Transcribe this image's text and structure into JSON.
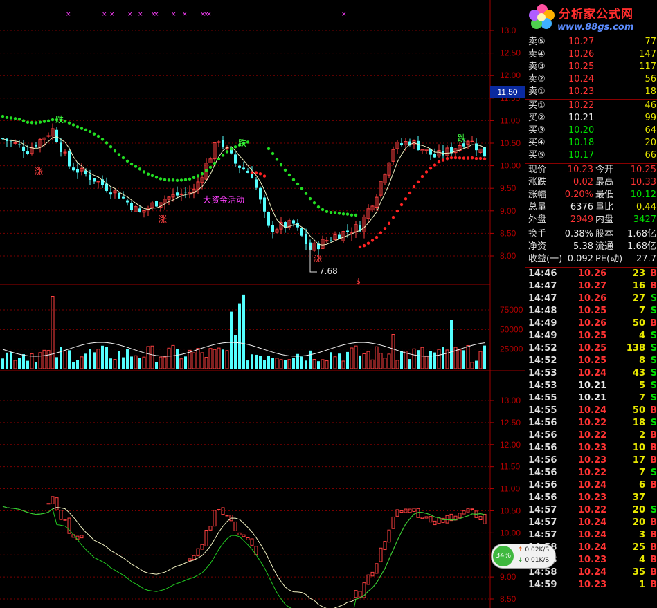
{
  "brand": {
    "title": "分析家公式网",
    "url": "www.88gs.com",
    "colors": {
      "title": "#ff2d2d",
      "url": "#5b8cff"
    }
  },
  "main_panel": {
    "y_ticks": [
      "13.0",
      "12.50",
      "12.00",
      "11.50",
      "11.00",
      "10.50",
      "10.00",
      "9.50",
      "9.00",
      "8.50",
      "8.00"
    ],
    "current_price_marker": "11.50",
    "annotations": {
      "up1": "涨",
      "up2": "涨",
      "up3": "涨",
      "down1": "跌",
      "down2": "跌",
      "big_fund": "大资金活动",
      "low_label": "7.68",
      "dollar": "$"
    }
  },
  "volume_panel": {
    "y_ticks": [
      "75000",
      "50000",
      "25000"
    ]
  },
  "lower_panel": {
    "y_ticks": [
      "13.00",
      "12.50",
      "12.00",
      "11.50",
      "11.00",
      "10.50",
      "10.00",
      "9.50",
      "9.00",
      "8.50"
    ]
  },
  "speed_widget": {
    "percent": "34%",
    "up": "0.02K/S",
    "down": "0.01K/S"
  },
  "order_book": {
    "sell": [
      {
        "label": "卖⑤",
        "price": "10.27",
        "vol": "77"
      },
      {
        "label": "卖④",
        "price": "10.26",
        "vol": "147"
      },
      {
        "label": "卖③",
        "price": "10.25",
        "vol": "117"
      },
      {
        "label": "卖②",
        "price": "10.24",
        "vol": "56"
      },
      {
        "label": "卖①",
        "price": "10.23",
        "vol": "18"
      }
    ],
    "buy": [
      {
        "label": "买①",
        "price": "10.22",
        "vol": "46"
      },
      {
        "label": "买②",
        "price": "10.21",
        "vol": "99"
      },
      {
        "label": "买③",
        "price": "10.20",
        "vol": "64"
      },
      {
        "label": "买④",
        "price": "10.18",
        "vol": "20"
      },
      {
        "label": "买⑤",
        "price": "10.17",
        "vol": "66"
      }
    ]
  },
  "quote": [
    {
      "l1": "现价",
      "v1": "10.23",
      "l2": "今开",
      "v2": "10.25"
    },
    {
      "l1": "涨跌",
      "v1": "0.02",
      "l2": "最高",
      "v2": "10.33"
    },
    {
      "l1": "涨幅",
      "v1": "0.20%",
      "l2": "最低",
      "v2": "10.12"
    },
    {
      "l1": "总量",
      "v1": "6376",
      "l2": "量比",
      "v2": "0.44"
    },
    {
      "l1": "外盘",
      "v1": "2949",
      "l2": "内盘",
      "v2": "3427"
    }
  ],
  "fundamentals": [
    {
      "l1": "换手",
      "v1": "0.38%",
      "l2": "股本",
      "v2": "1.68亿"
    },
    {
      "l1": "净资",
      "v1": "5.38",
      "l2": "流通",
      "v2": "1.68亿"
    },
    {
      "l1": "收益(一)",
      "v1": "0.092",
      "l2": "PE(动)",
      "v2": "27.7"
    }
  ],
  "ticks": [
    {
      "time": "14:46",
      "price": "10.26",
      "vol": "23",
      "bs": "B"
    },
    {
      "time": "14:47",
      "price": "10.27",
      "vol": "16",
      "bs": "B"
    },
    {
      "time": "14:47",
      "price": "10.26",
      "vol": "27",
      "bs": "S"
    },
    {
      "time": "14:48",
      "price": "10.25",
      "vol": "7",
      "bs": "S"
    },
    {
      "time": "14:49",
      "price": "10.26",
      "vol": "50",
      "bs": "B"
    },
    {
      "time": "14:49",
      "price": "10.25",
      "vol": "4",
      "bs": "S"
    },
    {
      "time": "14:52",
      "price": "10.25",
      "vol": "138",
      "bs": "S"
    },
    {
      "time": "14:52",
      "price": "10.25",
      "vol": "8",
      "bs": "S"
    },
    {
      "time": "14:53",
      "price": "10.24",
      "vol": "43",
      "bs": "S"
    },
    {
      "time": "14:53",
      "price": "10.21",
      "vol": "5",
      "bs": "S"
    },
    {
      "time": "14:55",
      "price": "10.21",
      "vol": "7",
      "bs": "S"
    },
    {
      "time": "14:55",
      "price": "10.24",
      "vol": "50",
      "bs": "B"
    },
    {
      "time": "14:56",
      "price": "10.22",
      "vol": "18",
      "bs": "S"
    },
    {
      "time": "14:56",
      "price": "10.22",
      "vol": "2",
      "bs": "B"
    },
    {
      "time": "14:56",
      "price": "10.23",
      "vol": "10",
      "bs": "B"
    },
    {
      "time": "14:56",
      "price": "10.23",
      "vol": "17",
      "bs": "B"
    },
    {
      "time": "14:56",
      "price": "10.22",
      "vol": "7",
      "bs": "S"
    },
    {
      "time": "14:56",
      "price": "10.24",
      "vol": "6",
      "bs": "B"
    },
    {
      "time": "14:56",
      "price": "10.23",
      "vol": "37",
      "bs": ""
    },
    {
      "time": "14:57",
      "price": "10.22",
      "vol": "20",
      "bs": "S"
    },
    {
      "time": "14:57",
      "price": "10.24",
      "vol": "20",
      "bs": "B"
    },
    {
      "time": "14:57",
      "price": "10.24",
      "vol": "3",
      "bs": "B"
    },
    {
      "time": "14:58",
      "price": "10.24",
      "vol": "25",
      "bs": "B"
    },
    {
      "time": "14:58",
      "price": "10.23",
      "vol": "4",
      "bs": "B"
    },
    {
      "time": "14:58",
      "price": "10.24",
      "vol": "35",
      "bs": "B"
    },
    {
      "time": "14:59",
      "price": "10.23",
      "vol": "1",
      "bs": "B"
    }
  ],
  "ticks_price_colors": {
    "10.21": "#e8e8e8"
  }
}
